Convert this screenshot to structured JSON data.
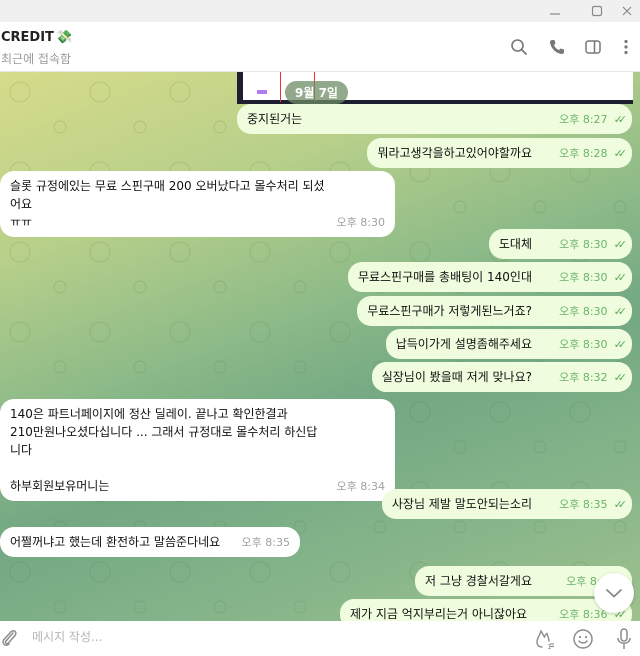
{
  "window": {
    "controls": {
      "minimize": "minimize",
      "maximize": "maximize",
      "close": "close"
    }
  },
  "header": {
    "chat_name": "CREDIT",
    "name_emoji": "💸",
    "status": "최근에 접속함",
    "icons": [
      "search-icon",
      "phone-icon",
      "side-panel-icon",
      "more-icon"
    ]
  },
  "date_pill": "9월 7일",
  "messages": [
    {
      "dir": "out",
      "text": "중지된거는",
      "time": "오후 8:27",
      "read": true
    },
    {
      "dir": "out",
      "text": "뭐라고생각을하고있어야할까요",
      "time": "오후 8:28",
      "read": true
    },
    {
      "dir": "in",
      "text": "슬롯 규정에있는 무료 스핀구매 200 오버났다고 몰수처리 되셨어요\nㅠㅠ",
      "time": "오후 8:30"
    },
    {
      "dir": "out",
      "text": "도대체",
      "time": "오후 8:30",
      "read": true
    },
    {
      "dir": "out",
      "text": "무료스핀구매를 총배팅이 140인대",
      "time": "오후 8:30",
      "read": true
    },
    {
      "dir": "out",
      "text": "무료스핀구매가 저렇게된느거죠?",
      "time": "오후 8:30",
      "read": true
    },
    {
      "dir": "out",
      "text": "납득이가게 설명좀해주세요",
      "time": "오후 8:30",
      "read": true
    },
    {
      "dir": "out",
      "text": "실장님이 봤을때 저게 맞나요?",
      "time": "오후 8:32",
      "read": true
    },
    {
      "dir": "in",
      "text": "140은 파트너페이지에 정산 딜레이. 끝나고 확인한결과\n210만원나오셨다십니다 ... 그래서 규정대로 몰수처리 하신답니다\n\n하부회원보유머니는",
      "time": "오후 8:34"
    },
    {
      "dir": "out",
      "text": "사장님 제발 말도안되는소리",
      "time": "오후 8:35",
      "read": true
    },
    {
      "dir": "in",
      "text": "어쩔꺼냐고 했는데 환전하고 말씀준다네요",
      "time": "오후 8:35"
    },
    {
      "dir": "out",
      "text": "저 그냥 경찰서갈게요",
      "time": "오후 8:3",
      "read": true
    },
    {
      "dir": "out",
      "text": "제가 지금 억지부리는거 아니잖아요",
      "time": "오후 8:36",
      "read": true
    }
  ],
  "composer": {
    "placeholder": "메시지 작성...",
    "value": ""
  },
  "colors": {
    "incoming_bubble": "#ffffff",
    "outgoing_bubble": "#effdde",
    "read_check": "#5aa95a",
    "outgoing_time": "#6bb36b"
  }
}
